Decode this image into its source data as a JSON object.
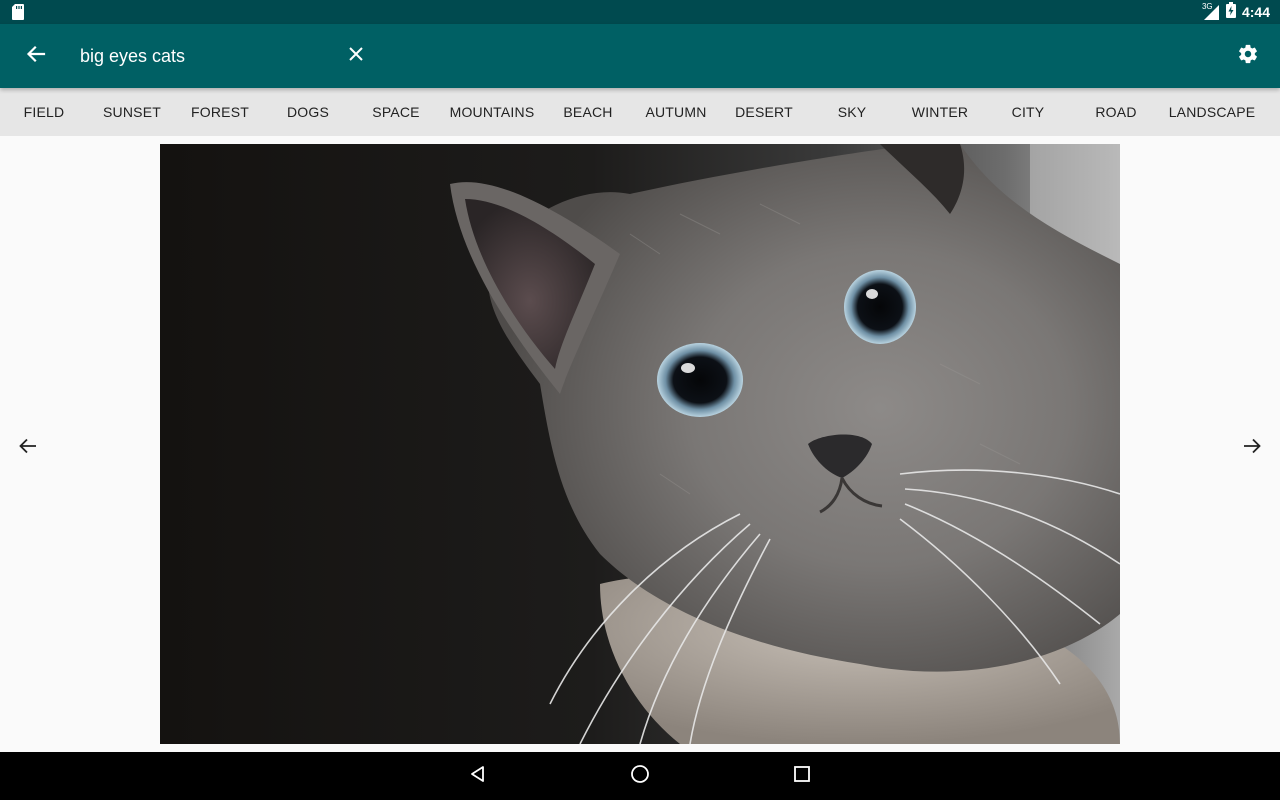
{
  "status_bar": {
    "time": "4:44",
    "network_type": "3G",
    "icons": [
      "sd-card-icon",
      "cell-signal-icon",
      "battery-icon"
    ]
  },
  "toolbar": {
    "search_value": "big eyes cats",
    "icons": [
      "arrow-back-icon",
      "close-icon",
      "settings-gear-icon"
    ],
    "background_color": "#006064"
  },
  "categories": [
    "FIELD",
    "SUNSET",
    "FOREST",
    "DOGS",
    "SPACE",
    "MOUNTAINS",
    "BEACH",
    "AUTUMN",
    "DESERT",
    "SKY",
    "WINTER",
    "CITY",
    "ROAD",
    "LANDSCAPE"
  ],
  "content": {
    "image_subject": "grey cat with big blue eyes",
    "icons": [
      "arrow-previous-icon",
      "arrow-next-icon"
    ]
  },
  "nav_bar": {
    "icons": [
      "nav-back-icon",
      "nav-home-icon",
      "nav-recents-icon"
    ]
  },
  "colors": {
    "status_bar": "#004a4f",
    "accent": "#006064",
    "category_bg": "#e6e6e6",
    "nav_bar": "#000000"
  }
}
